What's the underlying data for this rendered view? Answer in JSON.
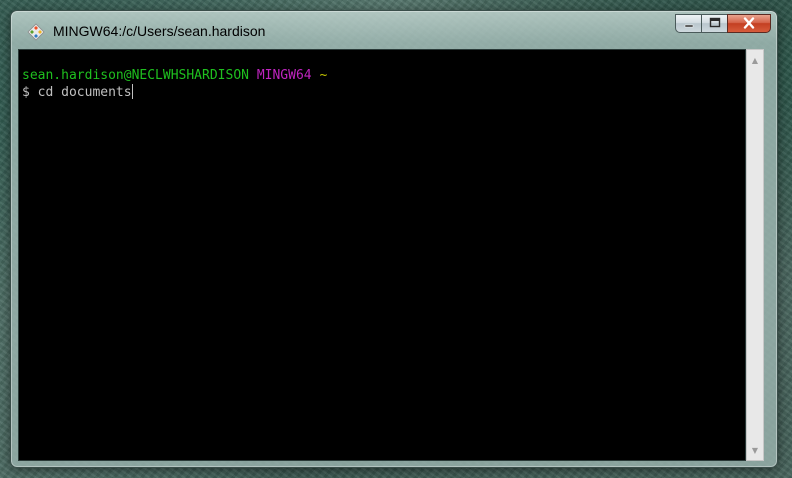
{
  "window": {
    "title": "MINGW64:/c/Users/sean.hardison"
  },
  "terminal": {
    "prompt_user_host": "sean.hardison@NECLWHSHARDISON",
    "prompt_env": "MINGW64",
    "prompt_dir": "~",
    "prompt_symbol": "$",
    "command": "cd documents"
  },
  "colors": {
    "prompt_user": "#1fc01f",
    "prompt_env": "#bf24bf",
    "prompt_dir": "#c0c000",
    "terminal_bg": "#000000",
    "terminal_fg": "#c0c0c0"
  },
  "icons": {
    "app": "git-bash-diamond-icon",
    "minimize": "minimize-icon",
    "maximize": "maximize-icon",
    "close": "close-icon",
    "scroll_up": "scroll-up-arrow-icon",
    "scroll_down": "scroll-down-arrow-icon"
  }
}
